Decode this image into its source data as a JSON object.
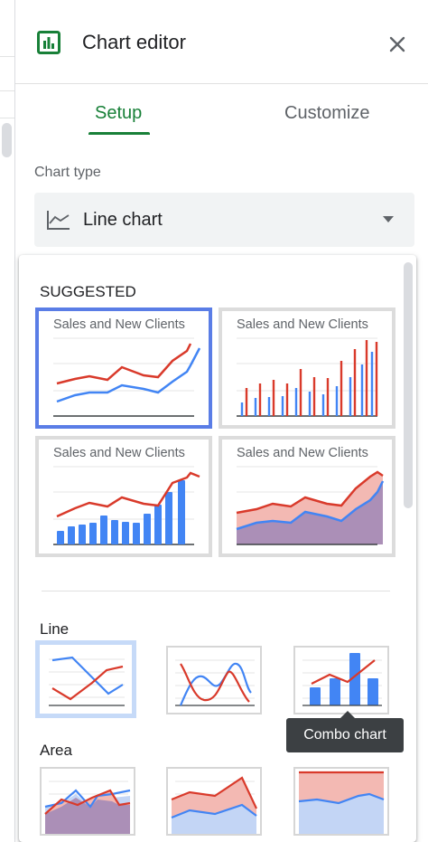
{
  "header": {
    "title": "Chart editor",
    "icon": "chart-icon",
    "close_icon": "close-icon"
  },
  "tabs": [
    {
      "label": "Setup",
      "active": true
    },
    {
      "label": "Customize",
      "active": false
    }
  ],
  "chart_type_label": "Chart type",
  "chart_type_dropdown": {
    "value": "Line chart",
    "icon": "line-chart-icon",
    "arrow_icon": "dropdown-arrow-icon"
  },
  "menu": {
    "suggested_title": "SUGGESTED",
    "suggested_cards": [
      {
        "title": "Sales and New Clients",
        "kind": "line",
        "selected": true
      },
      {
        "title": "Sales and New Clients",
        "kind": "column",
        "selected": false
      },
      {
        "title": "Sales and New Clients",
        "kind": "combo",
        "selected": false
      },
      {
        "title": "Sales and New Clients",
        "kind": "area",
        "selected": false
      }
    ],
    "line_title": "Line",
    "line_thumbs": [
      {
        "kind": "line",
        "selected": true
      },
      {
        "kind": "smooth-line",
        "selected": false
      },
      {
        "kind": "combo",
        "selected": false
      }
    ],
    "area_title": "Area",
    "area_thumbs": [
      {
        "kind": "area"
      },
      {
        "kind": "stacked-area"
      },
      {
        "kind": "100-stacked-area"
      }
    ],
    "tooltip": "Combo chart"
  },
  "colors": {
    "accent_green": "#188038",
    "series_red": "#d93a2b",
    "series_blue": "#4285f4",
    "selection_blue": "#5a7de6"
  }
}
